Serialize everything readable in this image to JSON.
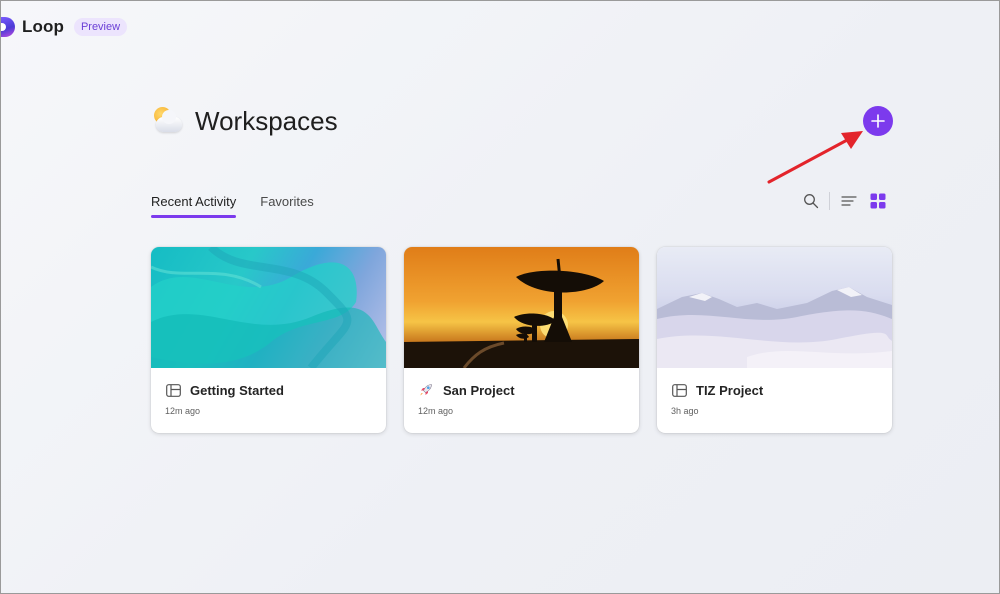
{
  "app": {
    "name": "Loop",
    "badge": "Preview"
  },
  "header": {
    "title": "Workspaces",
    "icon": "sun-behind-cloud-icon",
    "add_icon": "plus-icon"
  },
  "tabs": [
    {
      "label": "Recent Activity",
      "active": true
    },
    {
      "label": "Favorites",
      "active": false
    }
  ],
  "view_controls": {
    "search_icon": "search-icon",
    "list_icon": "list-view-icon",
    "grid_icon": "grid-view-icon",
    "selected": "grid"
  },
  "workspaces": [
    {
      "title": "Getting Started",
      "time": "12m ago",
      "icon": "workspace-layout-icon",
      "image": "teal-fabric-image"
    },
    {
      "title": "San Project",
      "time": "12m ago",
      "icon": "rocket-icon",
      "image": "radio-telescope-sunset-image"
    },
    {
      "title": "TIZ Project",
      "time": "3h ago",
      "icon": "workspace-layout-icon",
      "image": "snowy-desert-dunes-image"
    }
  ],
  "colors": {
    "accent": "#7c3aed",
    "annotation": "#e3242b"
  }
}
